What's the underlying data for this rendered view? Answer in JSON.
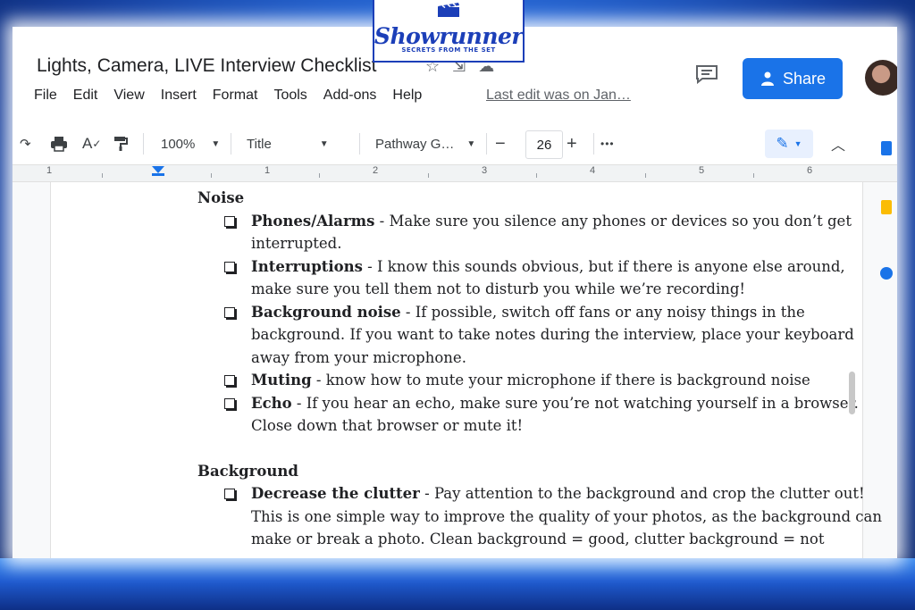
{
  "doc": {
    "title": "Lights, Camera, LIVE Interview Checklist"
  },
  "menu": [
    "File",
    "Edit",
    "View",
    "Insert",
    "Format",
    "Tools",
    "Add-ons",
    "Help"
  ],
  "last_edit": "Last edit was on Jan…",
  "share_label": "Share",
  "toolbar": {
    "zoom": "100%",
    "style": "Title",
    "font": "Pathway G…",
    "size": "26",
    "minus": "−",
    "plus": "+",
    "more": "•••"
  },
  "ruler_numbers": [
    "1",
    "1",
    "2",
    "3",
    "4",
    "5",
    "6"
  ],
  "content": {
    "noise_title": "Noise",
    "noise_items": [
      {
        "label": "Phones/Alarms",
        "text": " - Make sure you silence any phones or devices so you don’t get interrupted."
      },
      {
        "label": "Interruptions",
        "text": " - I know this sounds obvious, but if there is anyone else around, make sure you tell them not to disturb you while we’re recording!"
      },
      {
        "label": "Background noise",
        "text": " - If possible, switch off fans or any noisy things in the background. If you want to take notes during the interview, place your keyboard away from your microphone."
      },
      {
        "label": "Muting",
        "text": " - know how to mute your microphone if there is background noise"
      },
      {
        "label": "Echo",
        "text": " - If you hear an echo, make sure you’re not watching yourself in a browser. Close down that browser or mute it!"
      }
    ],
    "background_title": "Background",
    "background_items": [
      {
        "label": "Decrease the clutter",
        "text": " -  Pay attention to the background and crop the clutter out! This is one simple way to improve the quality of your photos, as the background can make or break a photo. Clean background = good, clutter background = not"
      }
    ]
  },
  "logo": {
    "word": "Showrunner",
    "tagline": "SECRETS FROM THE SET"
  },
  "colors": {
    "share_blue": "#1a73e8",
    "logo_blue": "#1c3fb8"
  }
}
